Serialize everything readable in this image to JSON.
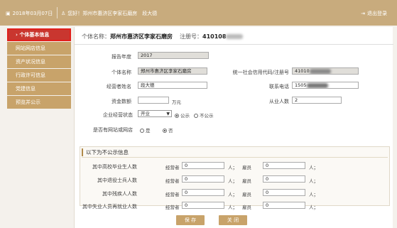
{
  "topbar": {
    "date": "2018年03月07日",
    "greeting": "您好！郑州市惠济区李家石磨房　段大德",
    "logout": "退出登录"
  },
  "sidebar": {
    "items": [
      {
        "label": "个体基本信息",
        "active": true
      },
      {
        "label": "网站网店信息"
      },
      {
        "label": "资产状况信息"
      },
      {
        "label": "行政许可信息"
      },
      {
        "label": "党建信息"
      },
      {
        "label": "预览并公示"
      }
    ]
  },
  "header": {
    "name_label": "个体名称：",
    "name_value": "郑州市惠济区李家石磨房",
    "reg_label": "注册号：",
    "reg_value": "410108"
  },
  "form": {
    "year_label": "报告年度",
    "year_value": "2017",
    "name_label": "个体名称",
    "name_value": "郑州市惠济区李家石磨房",
    "credit_label": "统一社会信用代码/注册号",
    "credit_value": "41010",
    "operator_label": "经营者姓名",
    "operator_value": "段大德",
    "phone_label": "联系电话",
    "phone_value": "1505",
    "capital_label": "资金数额",
    "capital_value": "",
    "capital_unit": "万元",
    "employees_label": "从业人数",
    "employees_value": "2",
    "status_label": "企业经营状态",
    "status_value": "开业",
    "publish_opt": "公示",
    "nopublish_opt": "不公示",
    "website_label": "是否有网站或网店",
    "yes": "是",
    "no": "否"
  },
  "private_section": {
    "title": "以下为不公示信息",
    "rows": [
      {
        "label": "其中高校毕业生人数",
        "op": "经营者",
        "op_val": "0",
        "unit1": "人；",
        "emp": "雇员",
        "emp_val": "0",
        "unit2": "人；"
      },
      {
        "label": "其中退役士兵人数",
        "op": "经营者",
        "op_val": "0",
        "unit1": "人；",
        "emp": "雇员",
        "emp_val": "0",
        "unit2": "人；"
      },
      {
        "label": "其中残疾人人数",
        "op": "经营者",
        "op_val": "0",
        "unit1": "人；",
        "emp": "雇员",
        "emp_val": "0",
        "unit2": "人；"
      },
      {
        "label": "其中失业人员再就业人数",
        "op": "经营者",
        "op_val": "0",
        "unit1": "人；",
        "emp": "雇员",
        "emp_val": "0",
        "unit2": "人；"
      }
    ]
  },
  "buttons": {
    "save": "保 存",
    "close": "关 闭"
  },
  "colors": {
    "brand": "#c8ab7d",
    "sidebar": "#c8a36a",
    "active": "#c9362f"
  }
}
